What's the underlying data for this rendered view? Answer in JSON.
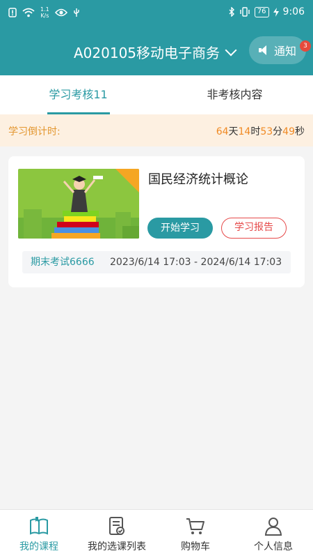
{
  "status_bar": {
    "net_speed_value": "1.1",
    "net_speed_unit": "K/s",
    "battery": "76",
    "time": "9:06"
  },
  "header": {
    "course_title": "A020105移动电子商务",
    "notice_label": "通知",
    "notice_badge": "3"
  },
  "tabs": [
    {
      "label": "学习考核11",
      "active": true
    },
    {
      "label": "非考核内容",
      "active": false
    }
  ],
  "countdown": {
    "label": "学习倒计时:",
    "days": "64",
    "days_unit": "天",
    "hours": "14",
    "hours_unit": "时",
    "minutes": "53",
    "minutes_unit": "分",
    "seconds": "49",
    "seconds_unit": "秒"
  },
  "course": {
    "name": "国民经济统计概论",
    "start_label": "开始学习",
    "report_label": "学习报告",
    "exam_name": "期末考试6666",
    "exam_range": "2023/6/14 17:03 - 2024/6/14 17:03"
  },
  "bottom_nav": [
    {
      "label": "我的课程",
      "icon": "book-icon",
      "active": true
    },
    {
      "label": "我的选课列表",
      "icon": "checklist-icon",
      "active": false
    },
    {
      "label": "购物车",
      "icon": "cart-icon",
      "active": false
    },
    {
      "label": "个人信息",
      "icon": "person-icon",
      "active": false
    }
  ],
  "colors": {
    "primary": "#2a9aa3",
    "countdown_bg": "#fdf0e1",
    "countdown_accent": "#f08a24",
    "report_red": "#e64a4a"
  }
}
